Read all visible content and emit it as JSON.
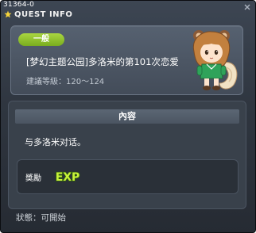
{
  "window": {
    "quest_id": "31364-0",
    "title": "QUEST INFO"
  },
  "quest": {
    "badge": "一般",
    "name": "[梦幻主题公园]多洛米的第101次恋爱",
    "level": "建議等級：120～124"
  },
  "content": {
    "header": "內容",
    "text": "与多洛米对话。"
  },
  "reward": {
    "label": "獎勵",
    "exp_text": "EXP"
  },
  "status": {
    "text": "狀態：可開始"
  },
  "colors": {
    "badge_green": "#8cc12a",
    "exp_green": "#c7f23a",
    "title_star": "#f5d33b"
  },
  "icons": [
    "star-icon",
    "close-icon",
    "npc-portrait",
    "exp-icon"
  ]
}
